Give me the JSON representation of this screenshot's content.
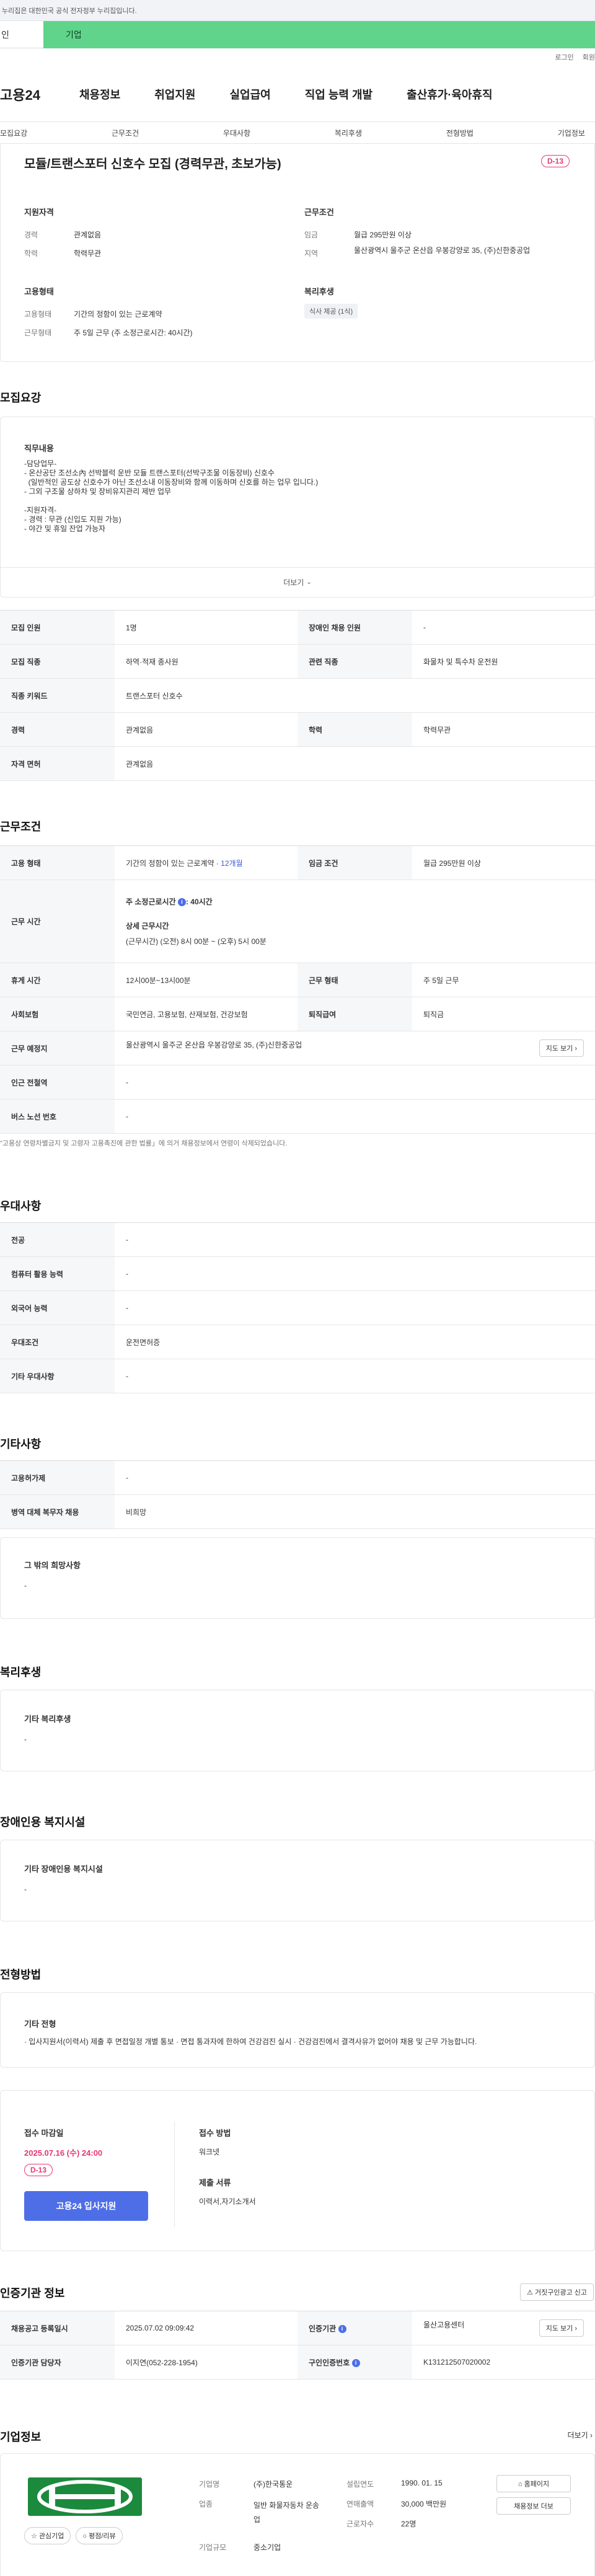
{
  "gov_banner": "이 누리집은 대한민국 공식 전자정부 누리집입니다.",
  "gov_banner_visible": "누리집은 대한민국 공식 전자정부 누리집입니다.",
  "user_tabs": {
    "individual": "인",
    "enterprise": "기업"
  },
  "utility": {
    "login": "로그인",
    "signup": "회원"
  },
  "logo": "고용24",
  "main_nav": [
    "채용정보",
    "취업지원",
    "실업급여",
    "직업 능력 개발",
    "출산휴가·육아휴직"
  ],
  "sub_nav": [
    "모집요강",
    "근무조건",
    "우대사항",
    "복리후생",
    "전형방법",
    "기업정보"
  ],
  "summary": {
    "title": "모듈/트랜스포터 신호수 모집 (경력무관, 초보가능)",
    "dday": "D-13",
    "qualification": {
      "heading": "지원자격",
      "career_label": "경력",
      "career": "관계없음",
      "edu_label": "학력",
      "edu": "학력무관"
    },
    "conditions": {
      "heading": "근무조건",
      "wage_label": "임금",
      "wage": "월급 295만원 이상",
      "region_label": "지역",
      "region": "울산광역시 울주군 온산읍 우봉강양로 35, (주)신한중공업"
    },
    "employment": {
      "heading": "고용형태",
      "type_label": "고용형태",
      "type": "기간의 정함이 있는 근로계약",
      "hours_label": "근무형태",
      "hours": "주 5일 근무 (주 소정근로시간: 40시간)"
    },
    "welfare": {
      "heading": "복리후생",
      "badge": "식사 제공 (1식)"
    }
  },
  "recruit": {
    "heading": "모집요강",
    "content_heading": "직무내용",
    "content_lines": [
      "-담당업무-",
      "- 온산공단 조선소內 선박블럭 운반 모듈 트랜스포터(선박구조물 이동장비) 신호수",
      "  (일반적인 공도상 신호수가 아닌 조선소내 이동장비와 함께 이동하며 신호를 하는 업무 입니다.)",
      "- 그외 구조물 상하차 및 장비유지관리 제반 업무",
      "",
      "-지원자격-",
      "- 경력 : 무관 (신입도 지원 가능)",
      "- 야간 및 휴일 잔업 가능자"
    ],
    "more": "더보기",
    "table": [
      {
        "k1": "모집 인원",
        "v1": "1명",
        "k2": "장애인 채용 인원",
        "v2": "-"
      },
      {
        "k1": "모집 직종",
        "v1": "하역·적재 종사원",
        "k2": "관련 직종",
        "v2": "화물차 및 특수차 운전원"
      },
      {
        "k1": "직종 키워드",
        "v1": "트랜스포터 신호수"
      },
      {
        "k1": "경력",
        "v1": "관계없음",
        "k2": "학력",
        "v2": "학력무관"
      },
      {
        "k1": "자격 면허",
        "v1": "관계없음"
      }
    ]
  },
  "work": {
    "heading": "근무조건",
    "type_label": "고용 형태",
    "type": "기간의 정함이 있는 근로계약 · ",
    "type_months": "12개월",
    "wage_label": "임금 조건",
    "wage": "월급 295만원 이상",
    "time_label": "근무 시간",
    "weekly": "주 소정근로시간",
    "weekly_val": ": 40시간",
    "detail_label": "상세 근무시간",
    "detail": "(근무시간) (오전) 8시 00분 ~ (오후) 5시 00분",
    "rest_label": "휴게 시간",
    "rest": "12시00분~13시00분",
    "form_label": "근무 형태",
    "form": "주 5일 근무",
    "ins_label": "사회보험",
    "ins": "국민연금, 고용보험, 산재보험, 건강보험",
    "sev_label": "퇴직급여",
    "sev": "퇴직금",
    "place_label": "근무 예정지",
    "place": "울산광역시 울주군 온산읍 우봉강양로 35, (주)신한중공업",
    "map_btn": "지도 보기",
    "subway_label": "인근 전철역",
    "subway": "-",
    "bus_label": "버스 노선 번호",
    "bus": "-",
    "note": "\"고용상 연령차별금지 및 고령자 고용촉진에 관한 법률」에 의거 채용정보에서 연령이 삭제되었습니다."
  },
  "prefer": {
    "heading": "우대사항",
    "rows": [
      {
        "k": "전공",
        "v": "-"
      },
      {
        "k": "컴퓨터 활용 능력",
        "v": "-"
      },
      {
        "k": "외국어 능력",
        "v": "-"
      },
      {
        "k": "우대조건",
        "v": "운전면허증"
      },
      {
        "k": "기타 우대사항",
        "v": "-"
      }
    ]
  },
  "etc": {
    "heading": "기타사항",
    "rows": [
      {
        "k": "고용허가제",
        "v": "-"
      },
      {
        "k": "병역 대체 복무자 채용",
        "v": "비희망"
      }
    ],
    "other_heading": "그 밖의 희망사항",
    "other": "-"
  },
  "benefit": {
    "heading": "복리후생",
    "box_heading": "기타 복리후생",
    "box": "-"
  },
  "disabled": {
    "heading": "장애인용 복지시설",
    "box_heading": "기타 장애인용 복지시설",
    "box": "-"
  },
  "selection": {
    "heading": "전형방법",
    "box_heading": "기타 전형",
    "box": "· 입사지원서(이력서) 제출 후 면접일정 개별 통보 · 면접 통과자에 한하여 건강검진 실시 · 건강검진에서 결격사유가 없어야 채용 및 근무 가능합니다.",
    "deadline_label": "접수 마감일",
    "deadline": "2025.07.16 (수) 24:00",
    "dday": "D-13",
    "apply": "고용24 입사지원",
    "method_label": "접수 방법",
    "method": "워크넷",
    "docs_label": "제출 서류",
    "docs": "이력서,자기소개서"
  },
  "cert": {
    "heading": "인증기관 정보",
    "report_btn": "거짓구인광고 신고",
    "reg_label": "채용공고 등록일시",
    "reg": "2025.07.02 09:09:42",
    "agency_label": "인증기관",
    "agency": "울산고용센터",
    "map_btn": "지도 보기",
    "manager_label": "인증기관 담당자",
    "manager": "이지연(052-228-1954)",
    "no_label": "구인인증번호",
    "no": "K131212507020002"
  },
  "company": {
    "heading": "기업정보",
    "more": "더보기",
    "fav": "관심기업",
    "review": "평점/리뷰",
    "name_label": "기업명",
    "name": "(주)한국통운",
    "industry_label": "업종",
    "industry": "일반 화물자동차 운송업",
    "size_label": "기업규모",
    "size": "중소기업",
    "est_label": "설립연도",
    "est": "1990. 01. 15",
    "revenue_label": "연매출액",
    "revenue": "30,000 백만원",
    "emp_label": "근로자수",
    "emp": "22명",
    "homepage": "홈페이지",
    "more_jobs": "채용정보 더보",
    "logo_color": "#1b8a3c"
  },
  "colors": {
    "accent": "#4e6ee8",
    "dday": "#e53970",
    "enterprise_tab": "#5fd48a"
  }
}
